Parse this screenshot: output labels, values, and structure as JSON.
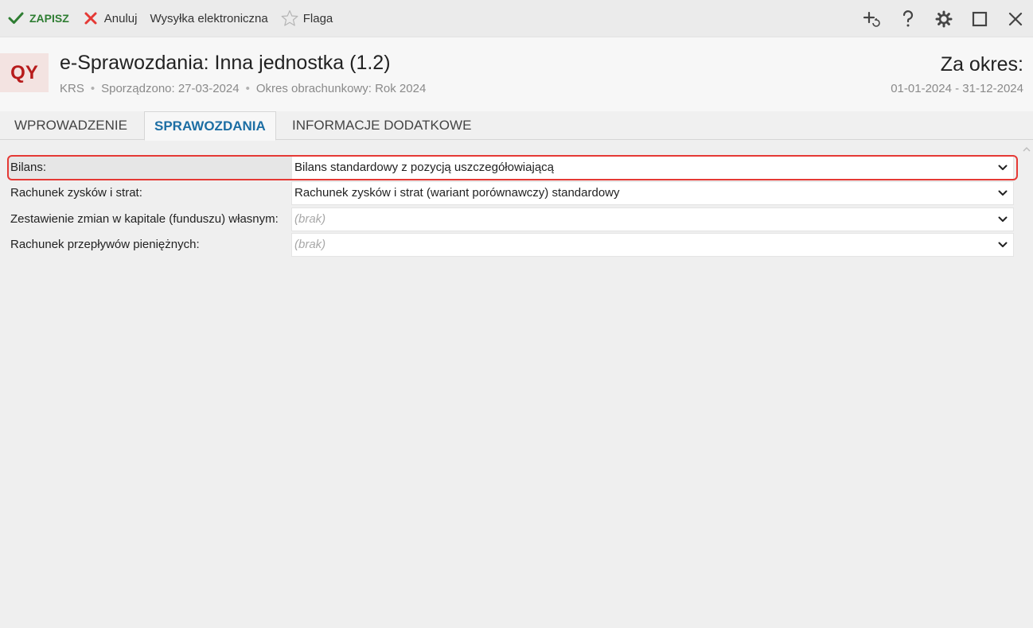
{
  "toolbar": {
    "save_label": "ZAPISZ",
    "cancel_label": "Anuluj",
    "send_label": "Wysyłka elektroniczna",
    "flag_label": "Flaga"
  },
  "header": {
    "logo_text": "QY",
    "title": "e-Sprawozdania: Inna jednostka (1.2)",
    "meta": {
      "registry": "KRS",
      "prepared": "Sporządzono: 27-03-2024",
      "fiscal_period": "Okres obrachunkowy: Rok 2024"
    },
    "period_label": "Za okres:",
    "period_value": "01-01-2024 - 31-12-2024"
  },
  "tabs": [
    {
      "label": "WPROWADZENIE",
      "active": false
    },
    {
      "label": "SPRAWOZDANIA",
      "active": true
    },
    {
      "label": "INFORMACJE DODATKOWE",
      "active": false
    }
  ],
  "form": {
    "rows": [
      {
        "label": "Bilans:",
        "value": "Bilans standardowy z pozycją uszczegółowiającą"
      },
      {
        "label": "Rachunek zysków i strat:",
        "value": "Rachunek zysków i strat (wariant porównawczy) standardowy"
      },
      {
        "label": "Zestawienie zmian w kapitale (funduszu) własnym:",
        "value": "(brak)"
      },
      {
        "label": "Rachunek przepływów pieniężnych:",
        "value": "(brak)"
      }
    ]
  },
  "colors": {
    "accent_tab": "#1c6ea4",
    "save_green": "#2e7d32",
    "cancel_red": "#e53935",
    "logo_red": "#b71c1c",
    "highlight": "#e53935"
  },
  "icons": [
    "check-icon",
    "close-x-icon",
    "star-icon",
    "add-list-icon",
    "help-icon",
    "gear-icon",
    "maximize-icon",
    "close-window-icon",
    "chevron-down-icon",
    "scroll-up-icon"
  ]
}
